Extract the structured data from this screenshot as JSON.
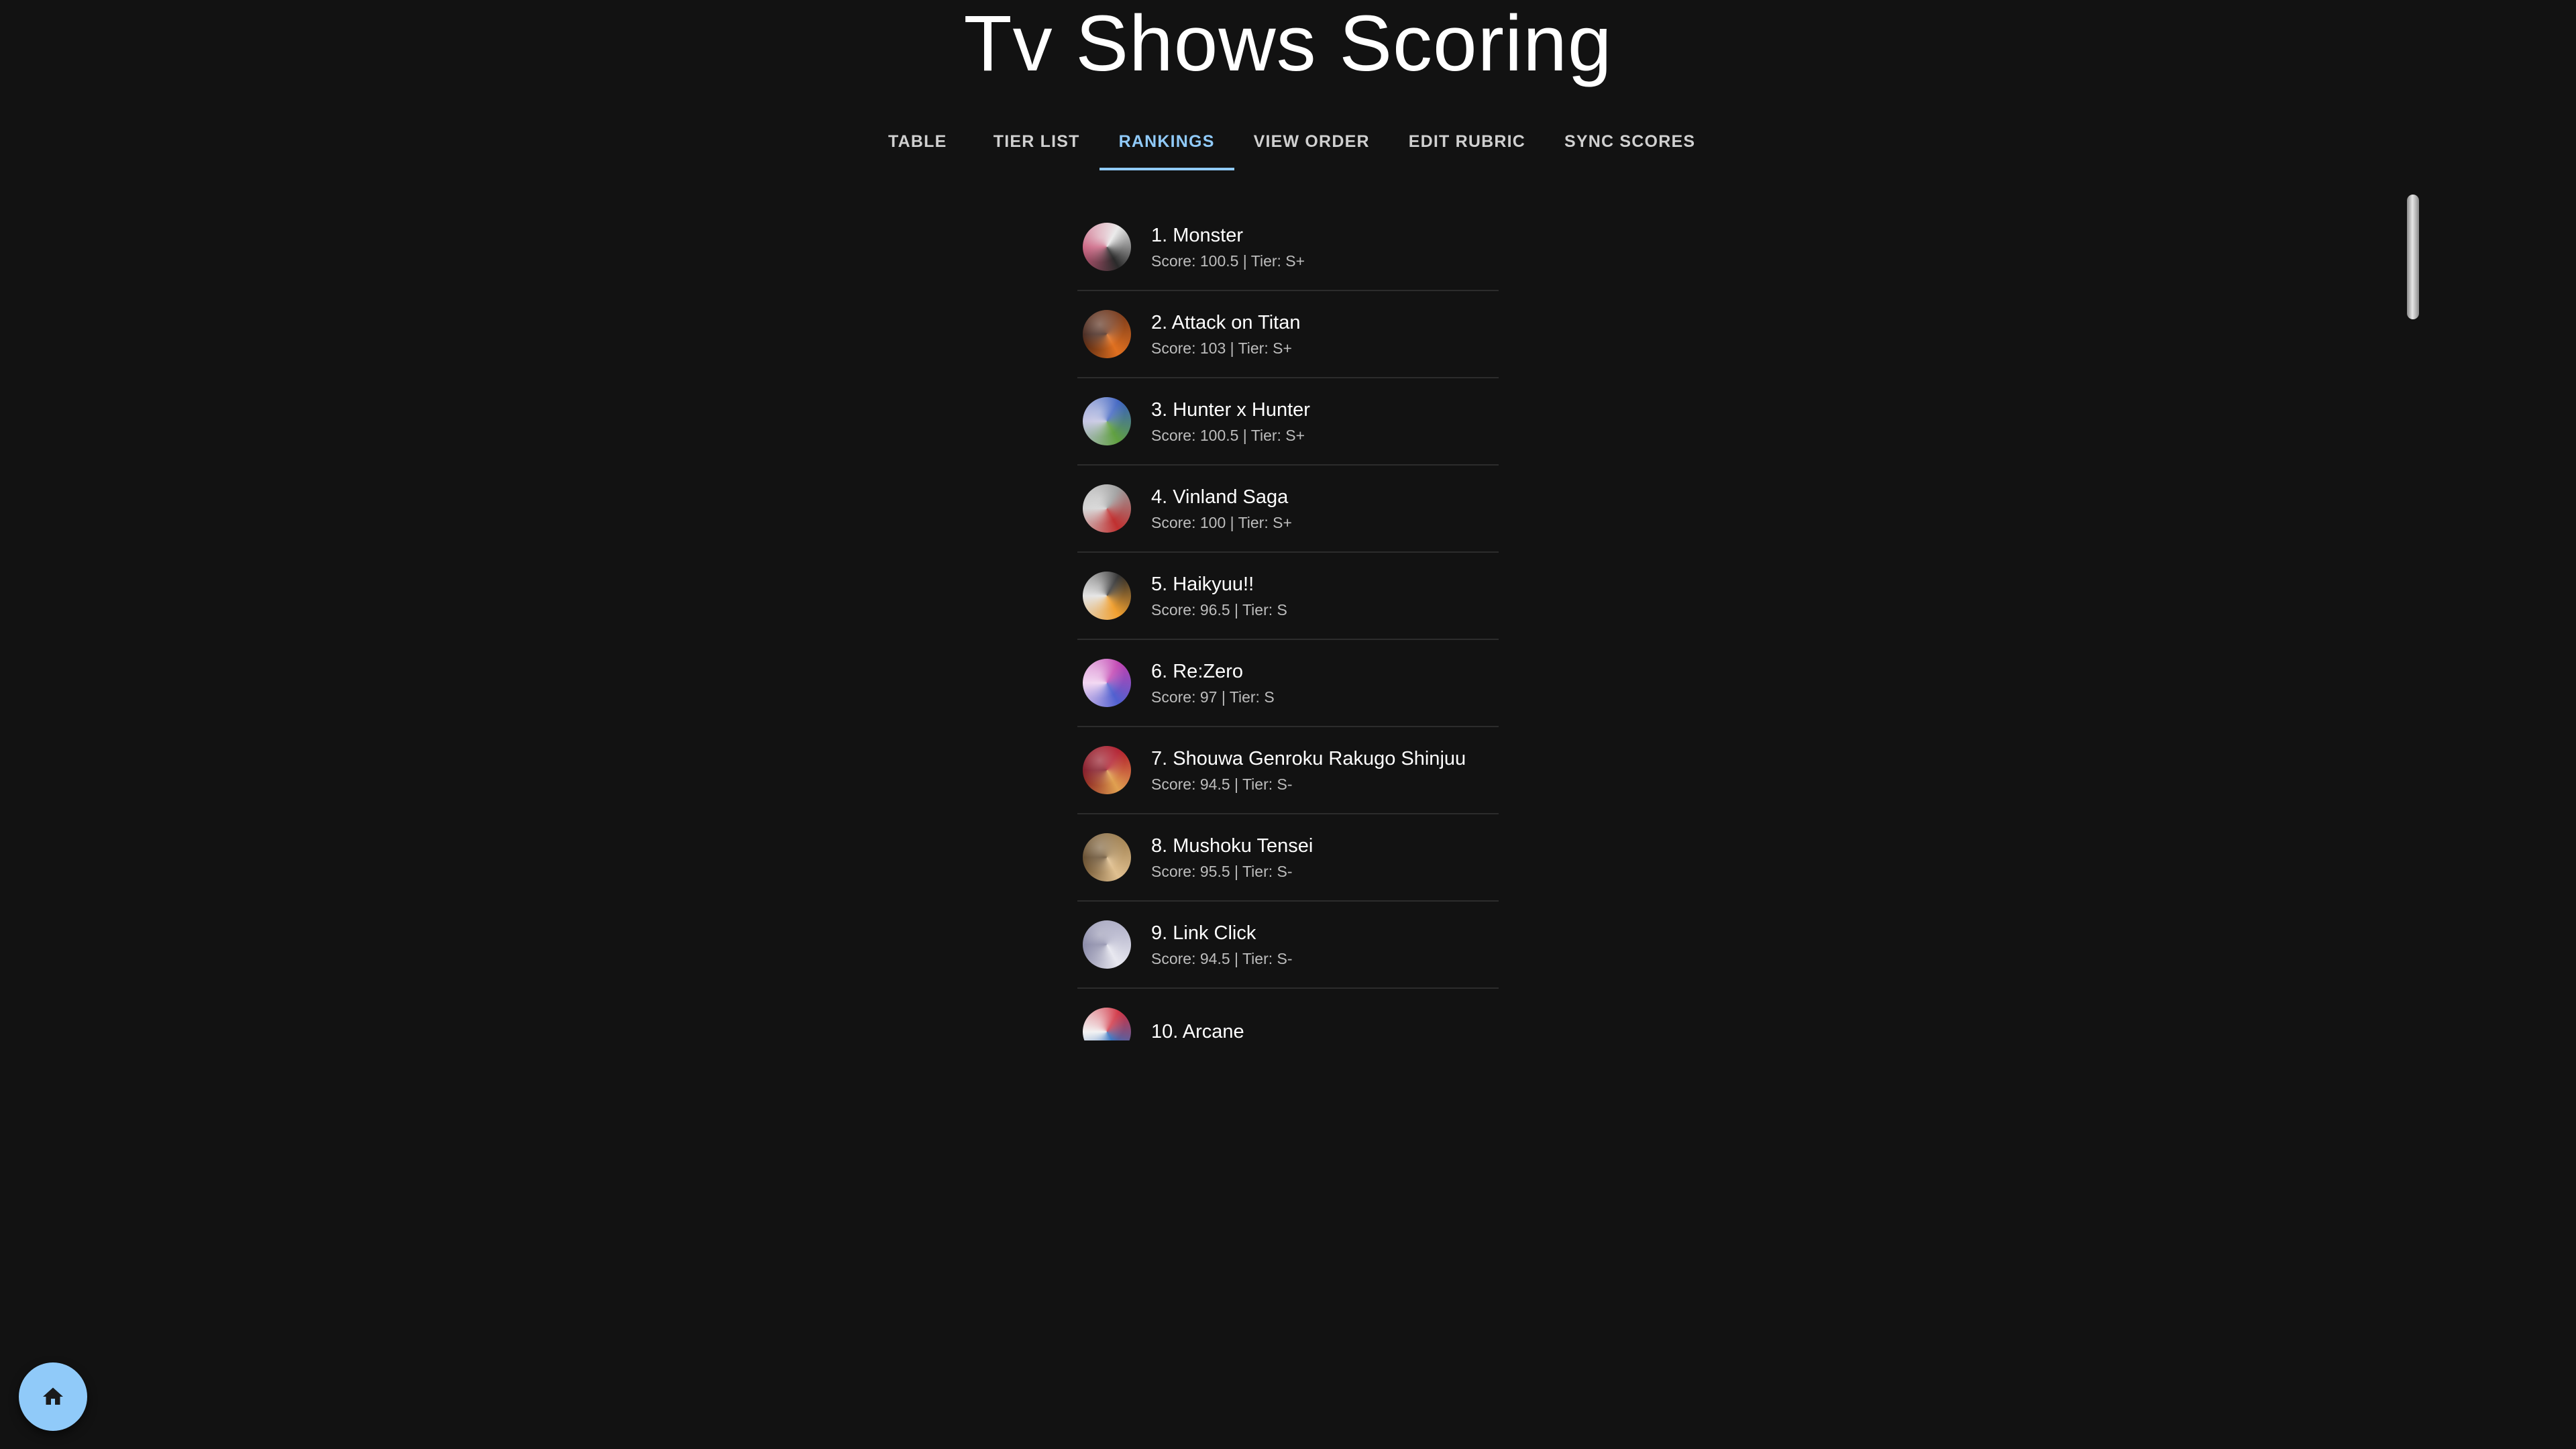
{
  "app": {
    "title": "Tv Shows Scoring"
  },
  "tabs": [
    {
      "label": "TABLE",
      "active": false
    },
    {
      "label": "TIER LIST",
      "active": false
    },
    {
      "label": "RANKINGS",
      "active": true
    },
    {
      "label": "VIEW ORDER",
      "active": false
    },
    {
      "label": "EDIT RUBRIC",
      "active": false
    },
    {
      "label": "SYNC SCORES",
      "active": false
    }
  ],
  "rankings": [
    {
      "name": "1. Monster",
      "meta": "Score: 100.5 | Tier: S+",
      "avatar_colors": [
        "#e8e8e8",
        "#2a2a2a",
        "#c85a7a"
      ]
    },
    {
      "name": "2. Attack on Titan",
      "meta": "Score: 103 | Tier: S+",
      "avatar_colors": [
        "#7a3a1a",
        "#e07020",
        "#3a1a10"
      ]
    },
    {
      "name": "3. Hunter x Hunter",
      "meta": "Score: 100.5 | Tier: S+",
      "avatar_colors": [
        "#3a60c0",
        "#60a040",
        "#c0c0e0"
      ]
    },
    {
      "name": "4. Vinland Saga",
      "meta": "Score: 100 | Tier: S+",
      "avatar_colors": [
        "#9a9a9a",
        "#c03030",
        "#d0d0d0"
      ]
    },
    {
      "name": "5. Haikyuu!!",
      "meta": "Score: 96.5 | Tier: S",
      "avatar_colors": [
        "#2a2a2a",
        "#f0a030",
        "#e0e0e0"
      ]
    },
    {
      "name": "6. Re:Zero",
      "meta": "Score: 97 | Tier: S",
      "avatar_colors": [
        "#c040b0",
        "#5060d0",
        "#f0d0f0"
      ]
    },
    {
      "name": "7. Shouwa Genroku Rakugo Shinjuu",
      "meta": "Score: 94.5 | Tier: S-",
      "avatar_colors": [
        "#b01a2a",
        "#e0a050",
        "#7a0a18"
      ]
    },
    {
      "name": "8. Mushoku Tensei",
      "meta": "Score: 95.5 | Tier: S-",
      "avatar_colors": [
        "#a08050",
        "#e0c090",
        "#5a4020"
      ]
    },
    {
      "name": "9. Link Click",
      "meta": "Score: 94.5 | Tier: S-",
      "avatar_colors": [
        "#b0b0c8",
        "#e8e8f0",
        "#8080a0"
      ]
    },
    {
      "name": "10. Arcane",
      "meta": "",
      "avatar_colors": [
        "#d03040",
        "#3070c0",
        "#f0f0f0"
      ]
    }
  ],
  "icons": {
    "home_fab": "home-icon"
  },
  "colors": {
    "background": "#121212",
    "accent": "#90caf9",
    "divider": "#2c2c2c"
  }
}
